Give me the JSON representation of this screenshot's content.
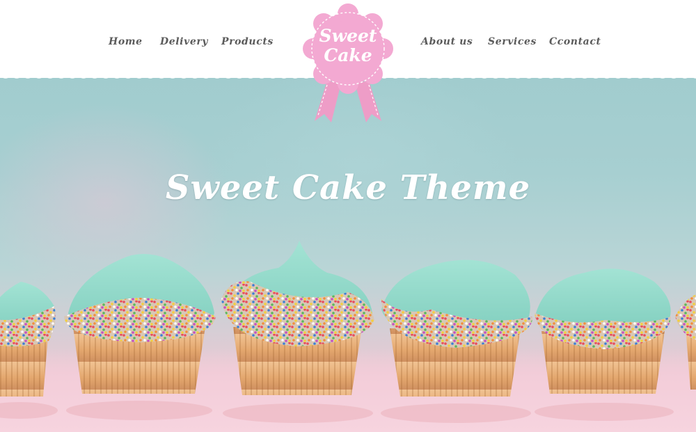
{
  "nav": {
    "left": [
      {
        "label": "Home"
      },
      {
        "label": "Delivery"
      },
      {
        "label": "Products"
      }
    ],
    "right": [
      {
        "label": "About us"
      },
      {
        "label": "Services"
      },
      {
        "label": "Ccontact"
      }
    ]
  },
  "logo": {
    "line1": "Sweet",
    "line2": "Cake",
    "badge_color": "#f3a9d2",
    "ribbon_color": "#ee9dc7"
  },
  "hero": {
    "title": "Sweet Cake Theme",
    "image_description": "row of cupcakes with mint frosting and rainbow sprinkles"
  },
  "colors": {
    "background_mint": "#9fc9cc",
    "frosting": "#8fd6c8",
    "wrapper": "#e8b27c",
    "table_pink": "#f3cdd9",
    "nav_text": "#5b5b5b"
  }
}
